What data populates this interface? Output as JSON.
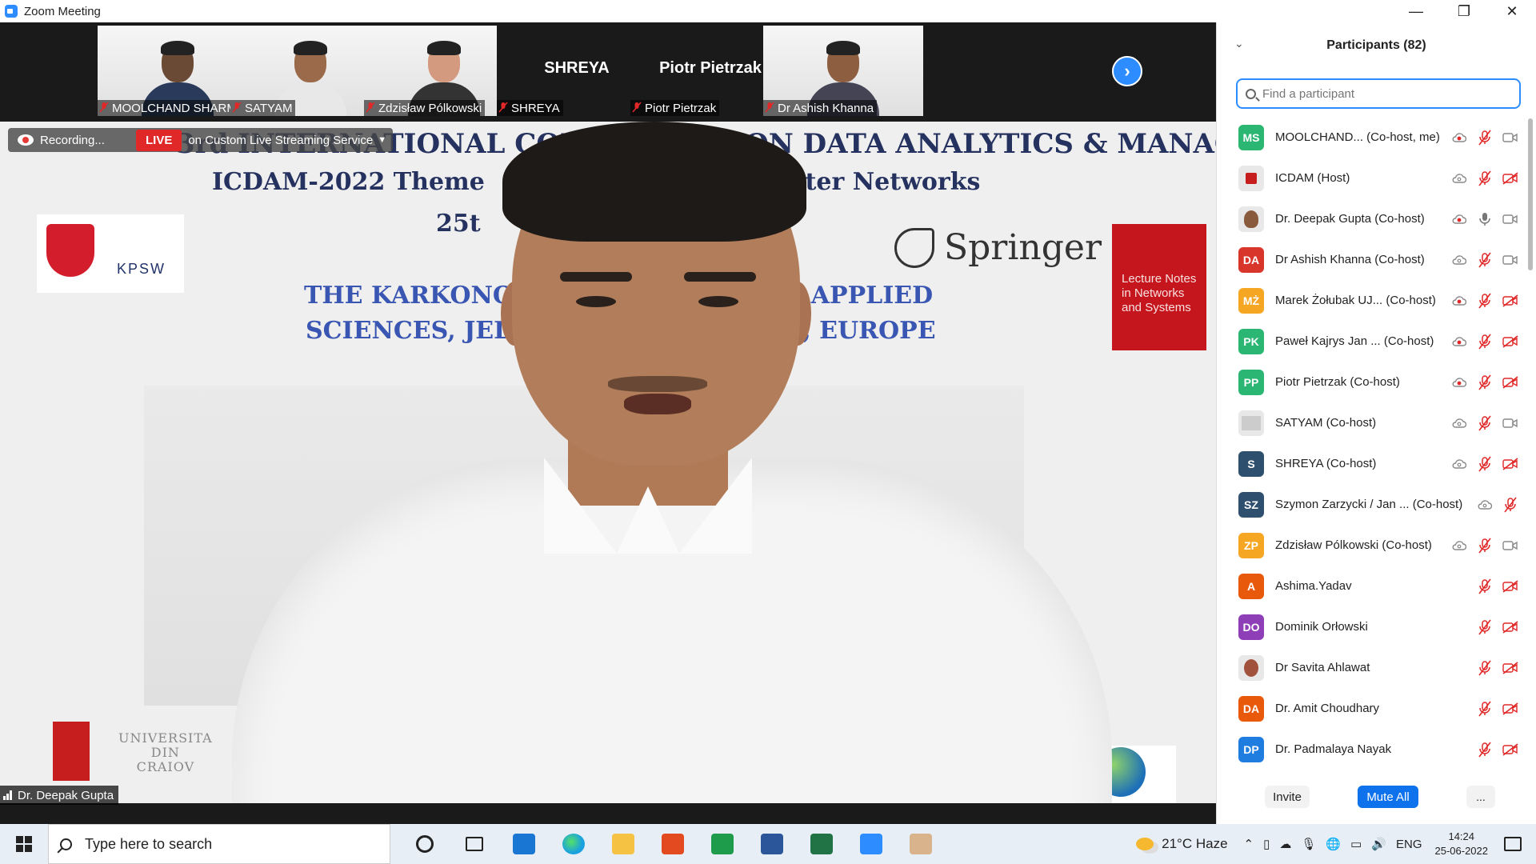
{
  "window": {
    "title": "Zoom Meeting",
    "controls": {
      "minimize": "—",
      "restore": "❐",
      "close": "✕"
    }
  },
  "thumbnails": [
    {
      "name": "MOOLCHAND SHARMA",
      "type": "video",
      "muted": true,
      "skin": "#6b4a35",
      "shirt": "#2a3a5a"
    },
    {
      "name": "SATYAM",
      "type": "video",
      "muted": true,
      "skin": "#9a6a4a",
      "shirt": "#e8e8e8"
    },
    {
      "name": "Zdzisław Pólkowski",
      "type": "video",
      "muted": true,
      "skin": "#d49a80",
      "shirt": "#333"
    },
    {
      "name": "SHREYA",
      "type": "name",
      "muted": true
    },
    {
      "name": "Piotr Pietrzak",
      "type": "name",
      "muted": true
    },
    {
      "name": "Dr Ashish Khanna",
      "type": "video",
      "muted": true,
      "skin": "#8d5e40",
      "shirt": "#445"
    }
  ],
  "recording": {
    "status": "Recording...",
    "live_badge": "LIVE",
    "live_service": "on Custom Live Streaming Service"
  },
  "speaker": {
    "name": "Dr. Deepak Gupta",
    "slide": {
      "line1": "3rd INTERNATIONAL CONFERENCE ON DATA ANALYTICS & MANAGEMENT",
      "line2": "ICDAM-2022 Theme",
      "line2b": "h Computer Networks",
      "line3": "25t",
      "line4a": "THE KARKONO",
      "line4b": "F APPLIED",
      "line5a": "SCIENCES, JEL",
      "line5b": "D, EUROPE",
      "logo_left": "KPSW",
      "logo_springer": "Springer",
      "book_title": "Lecture Notes in Networks and Systems",
      "univ_text": "UNIVERSITA\nDIN\nCRAIOV"
    }
  },
  "participants_panel": {
    "title": "Participants (82)",
    "search_placeholder": "Find a participant",
    "invite_label": "Invite",
    "mute_all_label": "Mute All",
    "more_label": "...",
    "participants": [
      {
        "initials": "MS",
        "color": "#2bb673",
        "name": "MOOLCHAND...  (Co-host, me)",
        "cloud": true,
        "cloud_active": true,
        "mic": "muted",
        "video": "on"
      },
      {
        "initials": "",
        "color": "#e8e8e8",
        "avatar_img": "logo",
        "name": "ICDAM (Host)",
        "cloud": true,
        "cloud_active": false,
        "mic": "muted",
        "video": "off"
      },
      {
        "initials": "",
        "color": "#e8e8e8",
        "avatar_img": "photo",
        "name": "Dr. Deepak Gupta (Co-host)",
        "cloud": true,
        "cloud_active": true,
        "mic": "on",
        "video": "on"
      },
      {
        "initials": "DA",
        "color": "#d9362b",
        "name": "Dr Ashish Khanna (Co-host)",
        "cloud": true,
        "cloud_active": false,
        "mic": "muted",
        "video": "on"
      },
      {
        "initials": "MŻ",
        "color": "#f5a623",
        "name": "Marek Żołubak UJ...  (Co-host)",
        "cloud": true,
        "cloud_active": true,
        "mic": "muted",
        "video": "off"
      },
      {
        "initials": "PK",
        "color": "#2bb673",
        "name": "Paweł Kajrys Jan ...  (Co-host)",
        "cloud": true,
        "cloud_active": true,
        "mic": "muted",
        "video": "off"
      },
      {
        "initials": "PP",
        "color": "#2bb673",
        "name": "Piotr Pietrzak (Co-host)",
        "cloud": true,
        "cloud_active": true,
        "mic": "muted",
        "video": "off"
      },
      {
        "initials": "",
        "color": "#e8e8e8",
        "avatar_img": "slide",
        "name": "SATYAM (Co-host)",
        "cloud": true,
        "cloud_active": false,
        "mic": "muted",
        "video": "on"
      },
      {
        "initials": "S",
        "color": "#2f4f6f",
        "name": "SHREYA (Co-host)",
        "cloud": true,
        "cloud_active": false,
        "mic": "muted",
        "video": "off"
      },
      {
        "initials": "SZ",
        "color": "#2f4f6f",
        "name": "Szymon Zarzycki / Jan ...  (Co-host)",
        "cloud": true,
        "cloud_active": false,
        "mic": "muted",
        "video": "none"
      },
      {
        "initials": "ZP",
        "color": "#f5a623",
        "name": "Zdzisław Pólkowski (Co-host)",
        "cloud": true,
        "cloud_active": false,
        "mic": "muted",
        "video": "on"
      },
      {
        "initials": "A",
        "color": "#e8590c",
        "name": "Ashima.Yadav",
        "cloud": false,
        "mic": "muted",
        "video": "off"
      },
      {
        "initials": "DO",
        "color": "#8e3fb8",
        "name": "Dominik Orłowski",
        "cloud": false,
        "mic": "muted",
        "video": "off"
      },
      {
        "initials": "",
        "color": "#e8e8e8",
        "avatar_img": "woman",
        "name": "Dr Savita Ahlawat",
        "cloud": false,
        "mic": "muted",
        "video": "off"
      },
      {
        "initials": "DA",
        "color": "#e8590c",
        "name": "Dr. Amit Choudhary",
        "cloud": false,
        "mic": "muted",
        "video": "off"
      },
      {
        "initials": "DP",
        "color": "#1f7de0",
        "name": "Dr. Padmalaya Nayak",
        "cloud": false,
        "mic": "muted",
        "video": "off"
      }
    ]
  },
  "taskbar": {
    "search_placeholder": "Type here to search",
    "apps": [
      {
        "name": "cortana",
        "color": "#222"
      },
      {
        "name": "task-view",
        "color": "#222"
      },
      {
        "name": "mail",
        "color": "#1976d2"
      },
      {
        "name": "edge",
        "color": "#1aa1e0"
      },
      {
        "name": "file-explorer",
        "color": "#f5c244"
      },
      {
        "name": "office",
        "color": "#e34a1f"
      },
      {
        "name": "chat",
        "color": "#1e9b4b"
      },
      {
        "name": "word",
        "color": "#2b579a"
      },
      {
        "name": "excel",
        "color": "#217346"
      },
      {
        "name": "zoom",
        "color": "#2d8cff"
      },
      {
        "name": "paint",
        "color": "#d9b38c"
      }
    ],
    "weather": "21°C  Haze",
    "language": "ENG",
    "time": "14:24",
    "date": "25-06-2022"
  }
}
